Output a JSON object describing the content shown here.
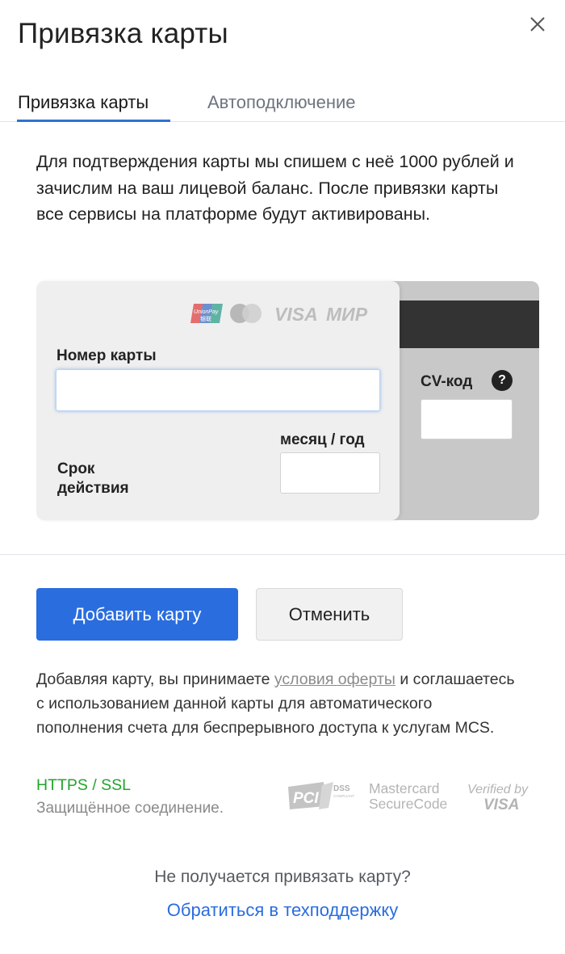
{
  "dialog": {
    "title": "Привязка карты",
    "close_icon": "close-icon"
  },
  "tabs": [
    {
      "label": "Привязка карты",
      "active": true
    },
    {
      "label": "Автоподключение",
      "active": false
    }
  ],
  "intro_text": "Для подтверждения карты мы спишем с неё 1000 рублей и зачислим на ваш лицевой баланс. После привязки карты все сервисы на платформе будут активированы.",
  "card": {
    "number_label": "Номер карты",
    "number_value": "",
    "expiry_label": "Срок действия",
    "expiry_sublabel": "месяц / год",
    "expiry_value": "",
    "cvc_label": "CV-код",
    "cvc_help": "?",
    "cvc_value": "",
    "logos": {
      "unionpay_line1": "UnionPay",
      "unionpay_line2": "银联",
      "visa": "VISA",
      "mir": "МИР"
    }
  },
  "actions": {
    "add_label": "Добавить карту",
    "cancel_label": "Отменить"
  },
  "terms": {
    "before": "Добавляя карту, вы принимаете ",
    "link": "условия оферты",
    "after": " и соглашаетесь с использованием данной карты для автоматического пополнения счета для беспрерывного доступа к услугам MCS."
  },
  "security": {
    "https": "HTTPS / SSL",
    "secure_text": "Защищённое соединение.",
    "badges": {
      "pci": "PCI",
      "dss": "DSS",
      "compliant": "COMPLIANT",
      "mc_line1": "Mastercard",
      "mc_line2": "SecureCode",
      "vv_line1": "Verified by",
      "vv_line2": "VISA"
    }
  },
  "help": {
    "question": "Не получается привязать карту?",
    "link": "Обратиться в техподдержку"
  },
  "colors": {
    "accent": "#2a6ddf",
    "tab_underline": "#2e72d2",
    "https_green": "#21a52b"
  }
}
